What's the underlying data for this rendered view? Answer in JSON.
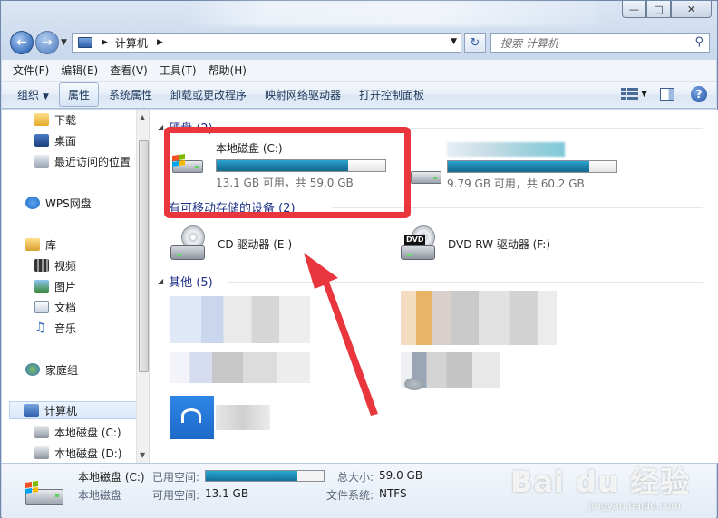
{
  "address": {
    "path": "计算机"
  },
  "search": {
    "placeholder": "搜索 计算机"
  },
  "menu": [
    "文件(F)",
    "编辑(E)",
    "查看(V)",
    "工具(T)",
    "帮助(H)"
  ],
  "toolbar": {
    "organize": "组织",
    "properties": "属性",
    "system_properties": "系统属性",
    "uninstall": "卸载或更改程序",
    "map_drive": "映射网络驱动器",
    "control_panel": "打开控制面板"
  },
  "sidebar": {
    "items": [
      {
        "label": "下载"
      },
      {
        "label": "桌面"
      },
      {
        "label": "最近访问的位置"
      },
      {
        "label": "WPS网盘"
      },
      {
        "label": "库"
      },
      {
        "label": "视频"
      },
      {
        "label": "图片"
      },
      {
        "label": "文档"
      },
      {
        "label": "音乐"
      },
      {
        "label": "家庭组"
      },
      {
        "label": "计算机"
      },
      {
        "label": "本地磁盘 (C:)"
      },
      {
        "label": "本地磁盘 (D:)"
      }
    ]
  },
  "groups": {
    "hdd": "硬盘 (2)",
    "removable": "有可移动存储的设备 (2)",
    "other": "其他 (5)"
  },
  "drives": {
    "c": {
      "name": "本地磁盘 (C:)",
      "info": "13.1 GB 可用，共 59.0 GB",
      "used_fraction": 0.78
    },
    "d": {
      "info": "9.79 GB 可用，共 60.2 GB",
      "used_fraction": 0.84
    },
    "cd": {
      "name": "CD 驱动器 (E:)"
    },
    "dvd": {
      "name": "DVD RW 驱动器 (F:)",
      "badge": "DVD"
    }
  },
  "details": {
    "title": "本地磁盘 (C:)",
    "type": "本地磁盘",
    "used_label": "已用空间:",
    "free_label": "可用空间:",
    "free_value": "13.1 GB",
    "total_label": "总大小:",
    "total_value": "59.0 GB",
    "fs_label": "文件系统:",
    "fs_value": "NTFS",
    "used_fraction": 0.78
  },
  "watermark": {
    "brand": "Bai du 经验",
    "url": "jingyan.baidu.com"
  },
  "colors": {
    "highlight": "#e8363c",
    "drive_fill": "#1e7fa8",
    "group_header": "#1e3287"
  }
}
